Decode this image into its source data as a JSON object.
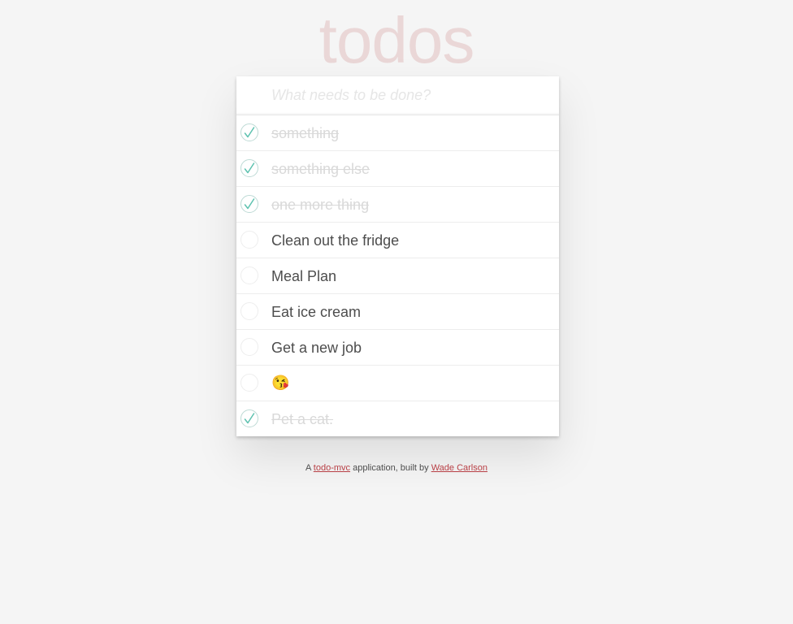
{
  "header": {
    "title": "todos"
  },
  "new_todo": {
    "placeholder": "What needs to be done?",
    "value": ""
  },
  "todos": [
    {
      "label": "something",
      "completed": true
    },
    {
      "label": "something else",
      "completed": true
    },
    {
      "label": "one more thing",
      "completed": true
    },
    {
      "label": "Clean out the fridge",
      "completed": false
    },
    {
      "label": "Meal Plan",
      "completed": false
    },
    {
      "label": "Eat ice cream",
      "completed": false
    },
    {
      "label": "Get a new job",
      "completed": false
    },
    {
      "label": "😘",
      "completed": false
    },
    {
      "label": "Pet a cat.",
      "completed": true
    }
  ],
  "footer": {
    "prefix": "A ",
    "link1_text": "todo-mvc",
    "middle": " application, built by ",
    "link2_text": "Wade Carlson"
  },
  "colors": {
    "title": "#eddada",
    "check": "#5dc2af",
    "link": "#b83f45"
  },
  "icons": {
    "completed_toggle": "checkmark-icon",
    "incomplete_toggle": "empty-circle-icon"
  }
}
